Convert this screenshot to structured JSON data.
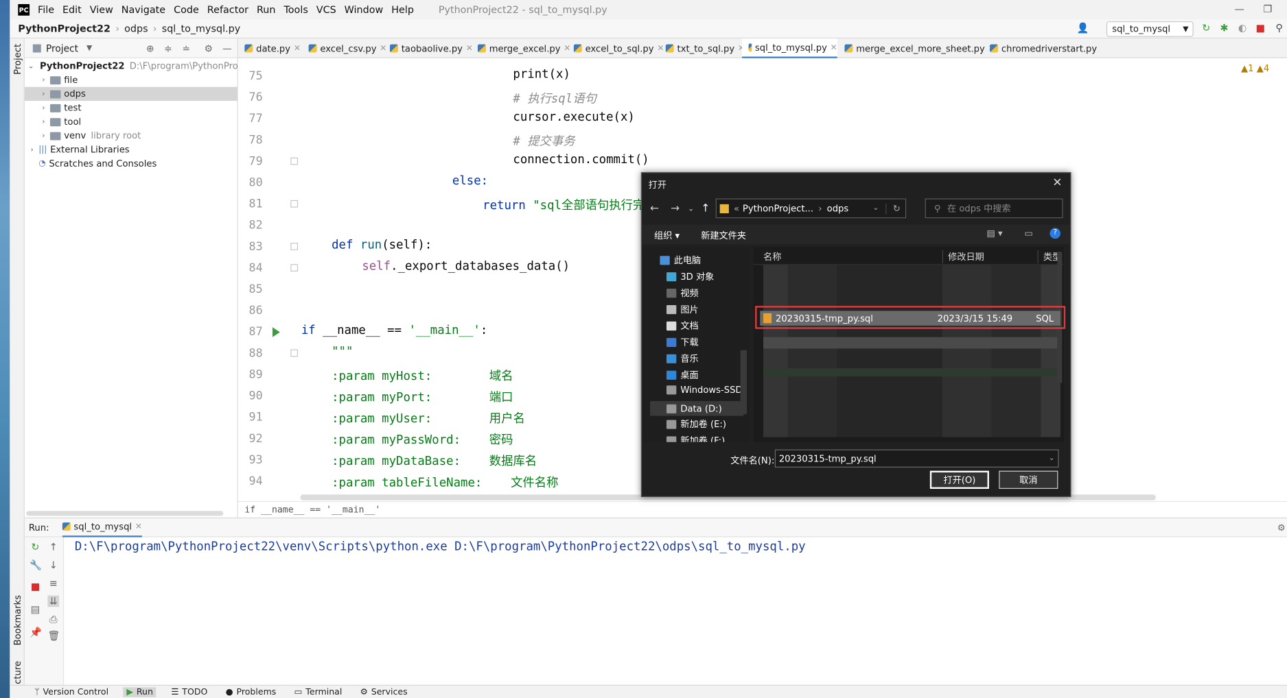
{
  "menubar": {
    "logo": "PC",
    "items": [
      "File",
      "Edit",
      "View",
      "Navigate",
      "Code",
      "Refactor",
      "Run",
      "Tools",
      "VCS",
      "Window",
      "Help"
    ],
    "window_title": "PythonProject22 - sql_to_mysql.py"
  },
  "navbar": {
    "project": "PythonProject22",
    "folder": "odps",
    "file": "sql_to_mysql.py",
    "run_config": "sql_to_mysql"
  },
  "toolstrip": {
    "project": "Project",
    "bookmarks": "Bookmarks",
    "structure": "Structure"
  },
  "project_panel": {
    "title": "Project",
    "root_name": "PythonProject22",
    "root_path": "D:\\F\\program\\PythonProjec",
    "items": [
      {
        "label": "file",
        "note": ""
      },
      {
        "label": "odps",
        "note": ""
      },
      {
        "label": "test",
        "note": ""
      },
      {
        "label": "tool",
        "note": ""
      },
      {
        "label": "venv",
        "note": "library root"
      }
    ],
    "external": "External Libraries",
    "scratches": "Scratches and Consoles"
  },
  "tabs": [
    "date.py",
    "excel_csv.py",
    "taobaolive.py",
    "merge_excel.py",
    "excel_to_sql.py",
    "txt_to_sql.py",
    "sql_to_mysql.py",
    "merge_excel_more_sheet.py",
    "chromedriverstart.py"
  ],
  "active_tab": "sql_to_mysql.py",
  "editor": {
    "warnings": "▲1 ▲4",
    "line_numbers": [
      "75",
      "76",
      "77",
      "78",
      "79",
      "80",
      "81",
      "82",
      "83",
      "84",
      "85",
      "86",
      "87",
      "88",
      "89",
      "90",
      "91",
      "92",
      "93",
      "94"
    ],
    "l75": "print(x)",
    "l76": "# 执行sql语句",
    "l77": "cursor.execute(x)",
    "l78": "# 提交事务",
    "l79": "connection.commit()",
    "l80": "else:",
    "l81_kw": "return",
    "l81_str": "\"sql全部语句执行完",
    "l83_kw": "def",
    "l83_fn": "run",
    "l83_rest": "(self):",
    "l84_self": "self",
    "l84_rest": "._export_databases_data()",
    "l87_kw": "if",
    "l87_rest": " __name__ == ",
    "l87_str": "'__main__'",
    "l87_colon": ":",
    "l88": "\"\"\"",
    "l89": ":param myHost:        域名",
    "l90": ":param myPort:        端口",
    "l91": ":param myUser:        用户名",
    "l92": ":param myPassWord:    密码",
    "l93": ":param myDataBase:    数据库名",
    "l94": ":param tableFileName:    文件名称",
    "breadcrumb": "if __name__ == '__main__'"
  },
  "run_panel": {
    "label": "Run:",
    "tab": "sql_to_mysql",
    "output": "D:\\F\\program\\PythonProject22\\venv\\Scripts\\python.exe D:\\F\\program\\PythonProject22\\odps\\sql_to_mysql.py"
  },
  "bottom_tabs": [
    "Version Control",
    "Run",
    "TODO",
    "Problems",
    "Terminal",
    "Services"
  ],
  "dialog": {
    "title": "打开",
    "address": [
      "PythonProject...",
      "odps"
    ],
    "search_placeholder": "在 odps 中搜索",
    "organize": "组织 ▾",
    "new_folder": "新建文件夹",
    "nav_items": [
      "此电脑",
      "3D 对象",
      "视频",
      "图片",
      "文档",
      "下载",
      "音乐",
      "桌面",
      "Windows-SSD",
      "Data (D:)",
      "新加卷 (E:)",
      "新加卷 (F:)"
    ],
    "columns": {
      "name": "名称",
      "date": "修改日期",
      "type": "类型"
    },
    "selected_file": {
      "name": "20230315-tmp_py.sql",
      "date": "2023/3/15 15:49",
      "type": "SQL"
    },
    "filename_label": "文件名(N):",
    "filename_value": "20230315-tmp_py.sql",
    "open_button": "打开(O)",
    "cancel_button": "取消"
  },
  "colors": {
    "keyword": "#0033b3",
    "string": "#067d17",
    "comment": "#8c8c8c",
    "highlight": "#e03a3a",
    "dialog_bg": "#202020"
  }
}
